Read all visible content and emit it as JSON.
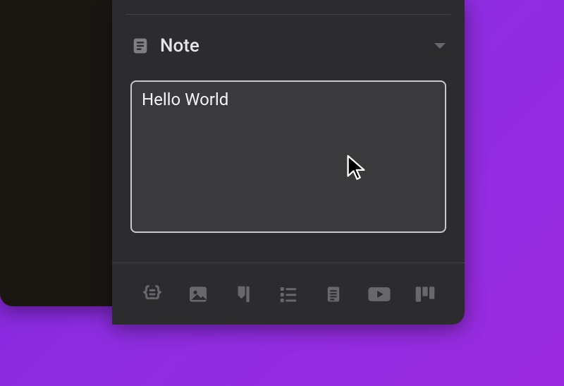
{
  "section": {
    "title": "Note"
  },
  "note": {
    "value": "Hello World"
  },
  "colors": {
    "panel": "#2c2c2e",
    "field": "#3a3a3c",
    "text": "#f5f5f7"
  },
  "toolbar_icons": [
    "curly-braces",
    "image",
    "annotate",
    "list",
    "document",
    "video",
    "kanban"
  ]
}
